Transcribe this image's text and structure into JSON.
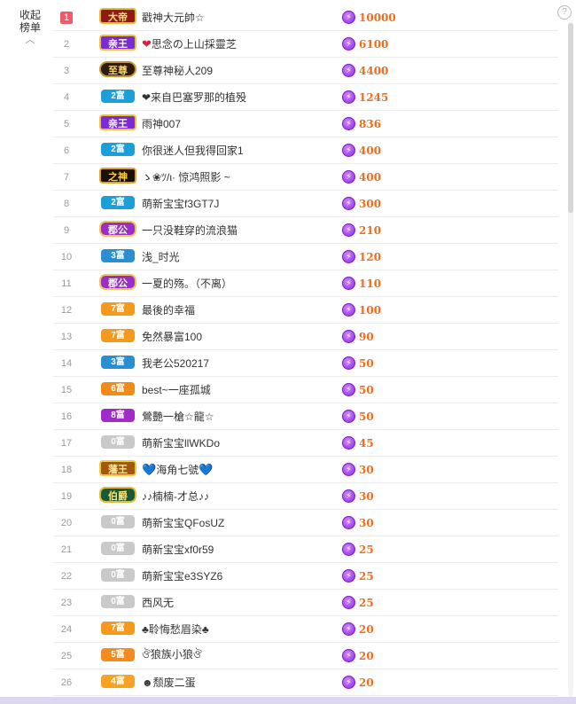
{
  "collapse": {
    "label_line1": "收起",
    "label_line2": "榜单"
  },
  "help": {
    "label": "?"
  },
  "rows": [
    {
      "rank": "1",
      "badge": "大帝",
      "badge_type": "dadi",
      "prefix": "",
      "name": "戳神大元帥☆",
      "suffix": "",
      "score": "10000"
    },
    {
      "rank": "2",
      "badge": "亲王",
      "badge_type": "qinwang",
      "prefix": "❤",
      "name": "思念の上山採靈芝",
      "suffix": "",
      "score": "6100"
    },
    {
      "rank": "3",
      "badge": "至尊",
      "badge_type": "zhizun",
      "prefix": "",
      "name": "至尊神秘人209",
      "suffix": "",
      "score": "4400"
    },
    {
      "rank": "4",
      "badge": "2富",
      "badge_type": "fu2",
      "prefix": "",
      "name": "❤来自巴塞罗那的植殁",
      "suffix": "",
      "score": "1245"
    },
    {
      "rank": "5",
      "badge": "亲王",
      "badge_type": "qinwang",
      "prefix": "",
      "name": "雨神007",
      "suffix": "",
      "score": "836"
    },
    {
      "rank": "6",
      "badge": "2富",
      "badge_type": "fu2",
      "prefix": "",
      "name": "你很迷人但我得回家1",
      "suffix": "",
      "score": "400"
    },
    {
      "rank": "7",
      "badge": "之神",
      "badge_type": "zhishen",
      "prefix": "",
      "name": "ゝ❀ﾂ/ι· 惊鸿照影 ~",
      "suffix": "",
      "score": "400"
    },
    {
      "rank": "8",
      "badge": "2富",
      "badge_type": "fu2",
      "prefix": "",
      "name": "萌新宝宝f3GT7J",
      "suffix": "",
      "score": "300"
    },
    {
      "rank": "9",
      "badge": "郡公",
      "badge_type": "junggong",
      "prefix": "",
      "name": "一只没鞋穿的流浪猫",
      "suffix": "",
      "score": "210"
    },
    {
      "rank": "10",
      "badge": "3富",
      "badge_type": "fu3",
      "prefix": "",
      "name": "浅_时光",
      "suffix": "",
      "score": "120"
    },
    {
      "rank": "11",
      "badge": "郡公",
      "badge_type": "junggong",
      "prefix": "",
      "name": "一夏的殇。（不离）",
      "suffix": "",
      "score": "110"
    },
    {
      "rank": "12",
      "badge": "7富",
      "badge_type": "fu7",
      "prefix": "",
      "name": "最後的幸福",
      "suffix": "",
      "score": "100"
    },
    {
      "rank": "13",
      "badge": "7富",
      "badge_type": "fu7",
      "prefix": "",
      "name": "免然暴富100",
      "suffix": "",
      "score": "90"
    },
    {
      "rank": "14",
      "badge": "3富",
      "badge_type": "fu3",
      "prefix": "",
      "name": "我老公520217",
      "suffix": "",
      "score": "50"
    },
    {
      "rank": "15",
      "badge": "6富",
      "badge_type": "fu6",
      "prefix": "",
      "name": "best~一座孤城",
      "suffix": "",
      "score": "50"
    },
    {
      "rank": "16",
      "badge": "8富",
      "badge_type": "fu8",
      "prefix": "",
      "name": "鶯艷一槍☆龍☆",
      "suffix": "",
      "score": "50"
    },
    {
      "rank": "17",
      "badge": "0富",
      "badge_type": "fu0",
      "prefix": "",
      "name": "萌新宝宝llWKDo",
      "suffix": "",
      "score": "45"
    },
    {
      "rank": "18",
      "badge": "藩王",
      "badge_type": "fanwang",
      "prefix": "💙",
      "name": "海角七號",
      "suffix": "💙",
      "score": "30"
    },
    {
      "rank": "19",
      "badge": "伯爵",
      "badge_type": "bojue",
      "prefix": "",
      "name": "♪♪楠楠-才总♪♪",
      "suffix": "",
      "score": "30"
    },
    {
      "rank": "20",
      "badge": "0富",
      "badge_type": "fu0",
      "prefix": "",
      "name": "萌新宝宝QFosUZ",
      "suffix": "",
      "score": "30"
    },
    {
      "rank": "21",
      "badge": "0富",
      "badge_type": "fu0",
      "prefix": "",
      "name": "萌新宝宝xf0r59",
      "suffix": "",
      "score": "25"
    },
    {
      "rank": "22",
      "badge": "0富",
      "badge_type": "fu0",
      "prefix": "",
      "name": "萌新宝宝e3SYZ6",
      "suffix": "",
      "score": "25"
    },
    {
      "rank": "23",
      "badge": "0富",
      "badge_type": "fu0",
      "prefix": "",
      "name": "西风无",
      "suffix": "",
      "score": "25"
    },
    {
      "rank": "24",
      "badge": "7富",
      "badge_type": "fu7",
      "prefix": "",
      "name": "♣聆悔愁眉染♣",
      "suffix": "",
      "score": "20"
    },
    {
      "rank": "25",
      "badge": "5富",
      "badge_type": "fu5",
      "prefix": "",
      "name": "ঔ狼族小狼ঔ",
      "suffix": "",
      "score": "20"
    },
    {
      "rank": "26",
      "badge": "4富",
      "badge_type": "fu4",
      "prefix": "",
      "name": "☻颓废二蛋",
      "suffix": "",
      "score": "20"
    }
  ]
}
